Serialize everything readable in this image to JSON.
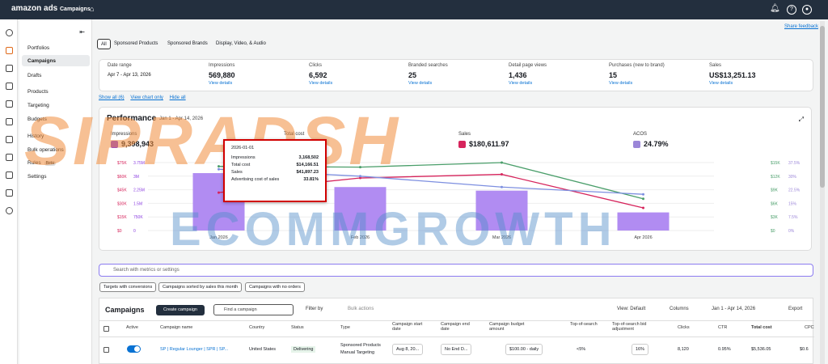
{
  "topbar": {
    "logo": "amazon ads",
    "nav": "Campaigns",
    "share": "Share feedback"
  },
  "menu": [
    "Portfolios",
    "Campaigns",
    "Drafts",
    "Products",
    "Targeting",
    "Budgets",
    "History",
    "Bulk operations",
    "Rules",
    "Settings"
  ],
  "rules_badge": "Beta",
  "tabs": [
    "All",
    "Sponsored Products",
    "Sponsored Brands",
    "Display, Video, & Audio"
  ],
  "date": {
    "label": "Date range",
    "value": "Apr 7 - Apr 13, 2026"
  },
  "metrics": [
    {
      "label": "Impressions",
      "value": "569,880",
      "link": "View details"
    },
    {
      "label": "Clicks",
      "value": "6,592",
      "link": "View details"
    },
    {
      "label": "Branded searches",
      "value": "25",
      "link": "View details"
    },
    {
      "label": "Detail page views",
      "value": "1,436",
      "link": "View details"
    },
    {
      "label": "Purchases (new to brand)",
      "value": "15",
      "link": "View details"
    },
    {
      "label": "Sales",
      "value": "US$13,251.13",
      "link": "View details"
    }
  ],
  "links": [
    "Show all (6)",
    "View chart only",
    "Hide all"
  ],
  "performance": {
    "title": "Performance",
    "date": "Jan 1 - Apr 14, 2026",
    "legend": [
      {
        "name": "Impressions",
        "value": "9,398,943",
        "color": "#8b3fe0"
      },
      {
        "name": "Total cost",
        "value": "",
        "color": "#4a9e6a"
      },
      {
        "name": "Sales",
        "value": "$180,611.97",
        "color": "#d6245c"
      },
      {
        "name": "ACOS",
        "value": "24.79%",
        "color": "#9b86d8"
      }
    ]
  },
  "tooltip": {
    "date": "2026-01-01",
    "rows": [
      {
        "label": "Impressions",
        "value": "3,168,502"
      },
      {
        "label": "Total cost",
        "value": "$14,166.51"
      },
      {
        "label": "Sales",
        "value": "$41,897.23"
      },
      {
        "label": "Advertising cost of sales",
        "value": "33.81%"
      }
    ]
  },
  "chart_data": {
    "type": "bar",
    "categories": [
      "Jan 2026",
      "Feb 2026",
      "Mar 2026",
      "Apr 2026"
    ],
    "series": [
      {
        "name": "Impressions",
        "values": [
          3168502,
          2400000,
          2200000,
          1000000
        ]
      },
      {
        "name": "Total cost",
        "values": [
          14166.51,
          14000,
          15000,
          7000
        ]
      },
      {
        "name": "Sales",
        "values": [
          41897.23,
          58000,
          62000,
          25000
        ]
      },
      {
        "name": "ACOS",
        "values": [
          33.81,
          30,
          24,
          20
        ]
      }
    ],
    "left_ticks_a": [
      "$75K",
      "$60K",
      "$45K",
      "$30K",
      "$15K",
      "$0"
    ],
    "left_ticks_b": [
      "3.75M",
      "3M",
      "2.25M",
      "1.5M",
      "750K",
      "0"
    ],
    "right_ticks_a": [
      "$15K",
      "$12K",
      "$9K",
      "$6K",
      "$3K",
      "$0"
    ],
    "right_ticks_b": [
      "37.5%",
      "30%",
      "22.5%",
      "15%",
      "7.5%",
      "0%"
    ]
  },
  "watermark": {
    "line1": "SIPRADSH",
    "line2": "ECOMMGROWTH"
  },
  "search": {
    "placeholder": "Search with metrics or settings"
  },
  "saved": [
    "Targets with conversions",
    "Campaigns sorted by sales this month",
    "Campaigns with no orders"
  ],
  "campaigns": {
    "title": "Campaigns",
    "create": "Create campaign",
    "find": "Find a campaign",
    "filter": "Filter by",
    "bulk": "Bulk actions",
    "view": "View: Default",
    "columns": "Columns",
    "range": "Jan 1 - Apr 14, 2026",
    "export": "Export",
    "headers": [
      "Active",
      "Campaign name",
      "Country",
      "Status",
      "Type",
      "Campaign start date",
      "Campaign end date",
      "Campaign budget amount",
      "Top-of-search",
      "Top-of-search bid adjustment",
      "Clicks",
      "CTR",
      "Total cost",
      "CPC"
    ],
    "row": {
      "name": "SP | Regular Lounger | SPR | SP...",
      "country": "United States",
      "status": "Delivering",
      "type": "Sponsored Products",
      "type2": "Manual Targeting",
      "start": "Aug 8, 20...",
      "end": "No End D...",
      "budget": "$100.00",
      "budget_unit": "daily",
      "tos": "<5%",
      "tos_adj": "16%",
      "clicks": "8,120",
      "ctr": "0.95%",
      "cost": "$5,536.05",
      "cpc": "$0.6"
    }
  }
}
